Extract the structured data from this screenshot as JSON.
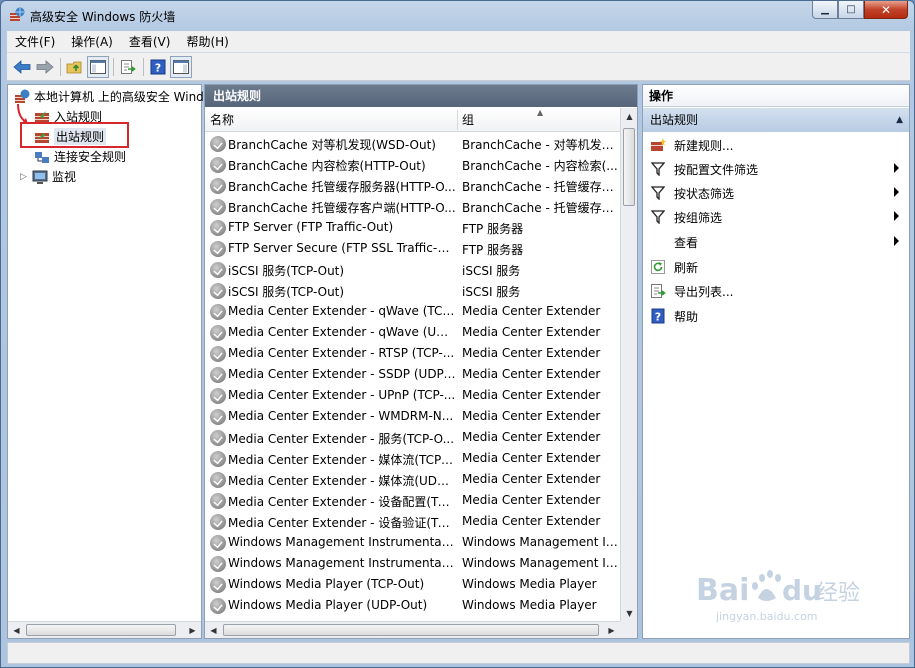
{
  "window": {
    "title": "高级安全 Windows 防火墙"
  },
  "menu": [
    "文件(F)",
    "操作(A)",
    "查看(V)",
    "帮助(H)"
  ],
  "tree": {
    "root": "本地计算机 上的高级安全 Wind",
    "items": [
      "入站规则",
      "出站规则",
      "连接安全规则",
      "监视"
    ]
  },
  "center": {
    "header": "出站规则",
    "columns": {
      "name": "名称",
      "group": "组"
    },
    "rows": [
      {
        "name": "BranchCache 对等机发现(WSD-Out)",
        "group": "BranchCache - 对等机发现..."
      },
      {
        "name": "BranchCache 内容检索(HTTP-Out)",
        "group": "BranchCache - 内容检索(..."
      },
      {
        "name": "BranchCache 托管缓存服务器(HTTP-O...",
        "group": "BranchCache - 托管缓存服..."
      },
      {
        "name": "BranchCache 托管缓存客户端(HTTP-O...",
        "group": "BranchCache - 托管缓存客..."
      },
      {
        "name": "FTP Server (FTP Traffic-Out)",
        "group": "FTP 服务器"
      },
      {
        "name": "FTP Server Secure (FTP SSL Traffic-Out)",
        "group": "FTP 服务器"
      },
      {
        "name": "iSCSI 服务(TCP-Out)",
        "group": "iSCSI 服务"
      },
      {
        "name": "iSCSI 服务(TCP-Out)",
        "group": "iSCSI 服务"
      },
      {
        "name": "Media Center Extender - qWave (TCP...",
        "group": "Media Center Extender"
      },
      {
        "name": "Media Center Extender - qWave (UD...",
        "group": "Media Center Extender"
      },
      {
        "name": "Media Center Extender - RTSP (TCP-...",
        "group": "Media Center Extender"
      },
      {
        "name": "Media Center Extender - SSDP (UDP-...",
        "group": "Media Center Extender"
      },
      {
        "name": "Media Center Extender - UPnP (TCP-...",
        "group": "Media Center Extender"
      },
      {
        "name": "Media Center Extender - WMDRM-N...",
        "group": "Media Center Extender"
      },
      {
        "name": "Media Center Extender - 服务(TCP-O...",
        "group": "Media Center Extender"
      },
      {
        "name": "Media Center Extender - 媒体流(TCP-...",
        "group": "Media Center Extender"
      },
      {
        "name": "Media Center Extender - 媒体流(UDP-...",
        "group": "Media Center Extender"
      },
      {
        "name": "Media Center Extender - 设备配置(TC...",
        "group": "Media Center Extender"
      },
      {
        "name": "Media Center Extender - 设备验证(TC...",
        "group": "Media Center Extender"
      },
      {
        "name": "Windows Management Instrumentati...",
        "group": "Windows Management In..."
      },
      {
        "name": "Windows Management Instrumentati...",
        "group": "Windows Management In..."
      },
      {
        "name": "Windows Media Player (TCP-Out)",
        "group": "Windows Media Player"
      },
      {
        "name": "Windows Media Player (UDP-Out)",
        "group": "Windows Media Player"
      }
    ]
  },
  "actions": {
    "header": "操作",
    "section": "出站规则",
    "items": [
      {
        "label": "新建规则...",
        "icon": "new-rule-icon"
      },
      {
        "label": "按配置文件筛选",
        "icon": "filter-icon"
      },
      {
        "label": "按状态筛选",
        "icon": "filter-icon"
      },
      {
        "label": "按组筛选",
        "icon": "filter-icon"
      },
      {
        "label": "查看",
        "icon": "none"
      },
      {
        "label": "刷新",
        "icon": "refresh-icon"
      },
      {
        "label": "导出列表...",
        "icon": "export-icon"
      },
      {
        "label": "帮助",
        "icon": "help-icon"
      }
    ]
  },
  "watermark": {
    "brand": "Bai",
    "brand_cn": "经验",
    "url": "jingyan.baidu.com"
  },
  "colors": {
    "highlight_box": "#d8262d",
    "pane_header": "#5f6d81",
    "action_section": "#c3d4e8"
  }
}
